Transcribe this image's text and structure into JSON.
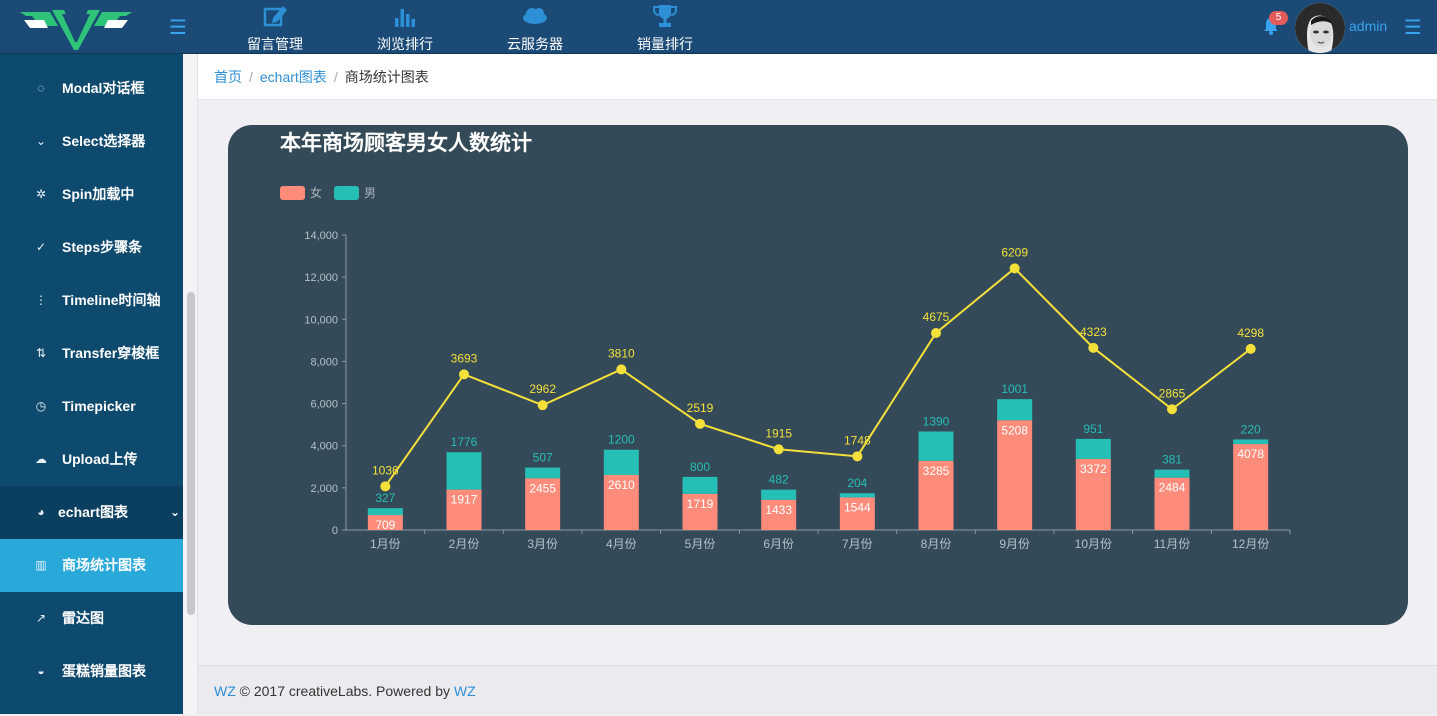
{
  "topbar": {
    "nav": [
      {
        "label": "留言管理",
        "icon": "edit-icon"
      },
      {
        "label": "浏览排行",
        "icon": "bar-chart-icon"
      },
      {
        "label": "云服务器",
        "icon": "cloud-icon"
      },
      {
        "label": "销量排行",
        "icon": "trophy-icon"
      }
    ],
    "notification_count": "5",
    "username": "admin"
  },
  "sidebar": {
    "items": [
      {
        "label": "Modal对话框",
        "icon": "comment-icon",
        "glyph": "◌"
      },
      {
        "label": "Select选择器",
        "icon": "chevron-down-icon",
        "glyph": "⌄"
      },
      {
        "label": "Spin加载中",
        "icon": "spinner-icon",
        "glyph": "✲"
      },
      {
        "label": "Steps步骤条",
        "icon": "check-circle-icon",
        "glyph": "✓"
      },
      {
        "label": "Timeline时间轴",
        "icon": "dots-vertical-icon",
        "glyph": "⋮"
      },
      {
        "label": "Transfer穿梭框",
        "icon": "transfer-icon",
        "glyph": "⇅"
      },
      {
        "label": "Timepicker",
        "icon": "clock-icon",
        "glyph": "◷"
      },
      {
        "label": "Upload上传",
        "icon": "cloud-upload-icon",
        "glyph": "☁"
      }
    ],
    "group": {
      "label": "echart图表",
      "icon": "pie-chart-icon",
      "glyph": "◕"
    },
    "sub_items": [
      {
        "label": "商场统计图表",
        "icon": "bar-chart-icon",
        "glyph": "▥",
        "active": true
      },
      {
        "label": "雷达图",
        "icon": "trend-icon",
        "glyph": "↗"
      },
      {
        "label": "蛋糕销量图表",
        "icon": "pie-icon",
        "glyph": "◒"
      }
    ]
  },
  "breadcrumb": {
    "home": "首页",
    "section": "echart图表",
    "current": "商场统计图表"
  },
  "chart_data": {
    "type": "bar",
    "title": "本年商场顾客男女人数统计",
    "categories": [
      "1月份",
      "2月份",
      "3月份",
      "4月份",
      "5月份",
      "6月份",
      "7月份",
      "8月份",
      "9月份",
      "10月份",
      "11月份",
      "12月份"
    ],
    "series": [
      {
        "name": "女",
        "type": "bar",
        "stack": "total",
        "color": "#ff8c7a",
        "values": [
          709,
          1917,
          2455,
          2610,
          1719,
          1433,
          1544,
          3285,
          5208,
          3372,
          2484,
          4078
        ]
      },
      {
        "name": "男",
        "type": "bar",
        "stack": "total",
        "color": "#26bfb5",
        "values": [
          327,
          1776,
          507,
          1200,
          800,
          482,
          204,
          1390,
          1001,
          951,
          381,
          220
        ]
      },
      {
        "type": "line",
        "color": "#f4e03a",
        "values": [
          1036,
          3693,
          2962,
          3810,
          2519,
          1915,
          1748,
          4675,
          6209,
          4323,
          2865,
          4298
        ]
      }
    ],
    "yticks": [
      "0",
      "2,000",
      "4,000",
      "6,000",
      "8,000",
      "10,000",
      "12,000",
      "14,000"
    ],
    "ylim": [
      0,
      14000
    ],
    "xlabel": "",
    "ylabel": "",
    "legend_position": "top-left",
    "grid": false
  },
  "footer": {
    "brand": "WZ",
    "text": " © 2017 creativeLabs. Powered by ",
    "powered": "WZ"
  },
  "colors": {
    "topbar": "#1a4a75",
    "sidebar": "#0e4a6e",
    "active": "#29a8da",
    "chart_bg": "#344a58",
    "link": "#2d8fd5"
  }
}
